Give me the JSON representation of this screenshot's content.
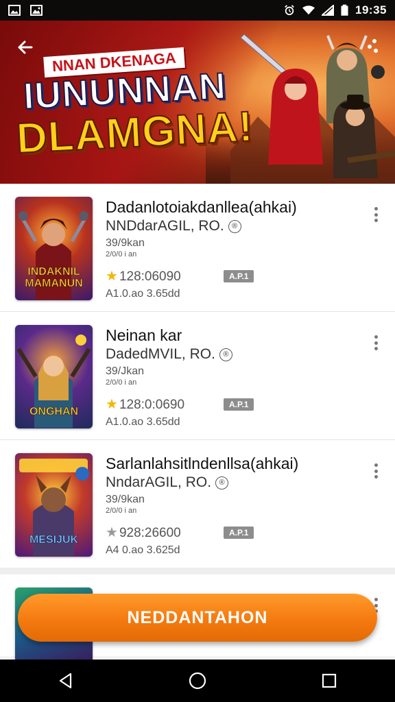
{
  "status_bar": {
    "time": "19:35",
    "icons": [
      "image-icon",
      "gallery-icon",
      "alarm-icon",
      "wifi-icon",
      "signal-icon",
      "battery-icon"
    ]
  },
  "banner": {
    "subtitle": "NNAN DKENAGA",
    "title_line1": "IUNUNNAN",
    "title_line2": "DLAMGNA!",
    "back_icon": "arrow-left-icon",
    "share_icon": "share-icon"
  },
  "games": [
    {
      "title": "Dadanlotoiakdanllea(ahkai)",
      "developer": "NNDdarAGIL, RO.",
      "dev_badge": "®",
      "meta_line1": "39/9kan",
      "meta_line2": "2/0/0 i an",
      "rating": "128:06090",
      "tag": "A.P.1",
      "size": "A1.0.ao 3.65dd",
      "thumb_caption": "INDAKNIL MAMANUN",
      "star_color": "#f2b705",
      "thumb_colors": [
        "#3a1a6a",
        "#b8321e",
        "#ffb13a"
      ]
    },
    {
      "title": "Neinan kar",
      "developer": "DadedMVIL, RO.",
      "dev_badge": "®",
      "meta_line1": "39/Jkan",
      "meta_line2": "2/0/0 i an",
      "rating": "128:0:0690",
      "tag": "A.P.1",
      "size": "A1.0.ao 3.65dd",
      "thumb_caption": "ONGHAN",
      "star_color": "#f2b705",
      "thumb_colors": [
        "#1e2b5a",
        "#5a2a8a",
        "#f4a23a"
      ]
    },
    {
      "title": "Sarlanlahsitlndenllsa(ahkai)",
      "developer": "NndarAGIL, RO.",
      "dev_badge": "®",
      "meta_line1": "39/9kan",
      "meta_line2": "2/0/0 i an",
      "rating": "928:26600",
      "tag": "A.P.1",
      "size": "A4 0.ao 3.625d",
      "thumb_caption": "MESIJUK",
      "star_color": "#9a9a9a",
      "thumb_colors": [
        "#4a1a7a",
        "#c23a2a",
        "#ffcf3a"
      ]
    }
  ],
  "cta": {
    "label": "NEDDANTAHON"
  },
  "nav": {
    "back_icon": "nav-back-icon",
    "home_icon": "nav-home-icon",
    "recents_icon": "nav-recents-icon"
  }
}
